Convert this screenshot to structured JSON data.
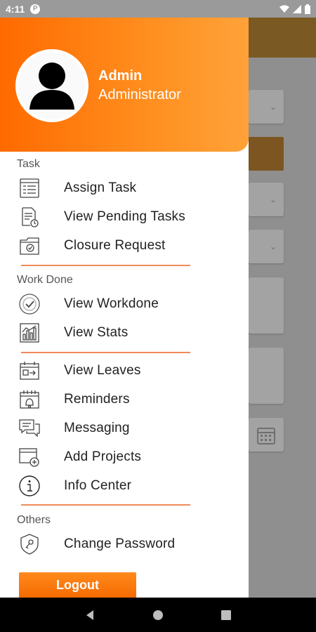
{
  "status_bar": {
    "time": "4:11",
    "badge": "P"
  },
  "header": {
    "user_name": "Admin",
    "user_role": "Administrator"
  },
  "sections": {
    "task": "Task",
    "work_done": "Work Done",
    "others": "Others"
  },
  "menu": {
    "assign_task": "Assign Task",
    "view_pending_tasks": "View Pending Tasks",
    "closure_request": "Closure Request",
    "view_workdone": "View Workdone",
    "view_stats": "View Stats",
    "view_leaves": "View Leaves",
    "reminders": "Reminders",
    "messaging": "Messaging",
    "add_projects": "Add Projects",
    "info_center": "Info Center",
    "change_password": "Change Password"
  },
  "logout_label": "Logout",
  "colors": {
    "accent": "#ff7a0f",
    "divider": "#f08a59",
    "text": "#222222"
  },
  "icons": [
    "profile-avatar-icon",
    "assign-task-icon",
    "pending-tasks-icon",
    "closure-request-icon",
    "workdone-check-icon",
    "stats-icon",
    "leaves-icon",
    "reminders-icon",
    "messaging-icon",
    "add-projects-icon",
    "info-icon",
    "change-password-icon",
    "back-icon",
    "home-icon",
    "recents-icon"
  ]
}
